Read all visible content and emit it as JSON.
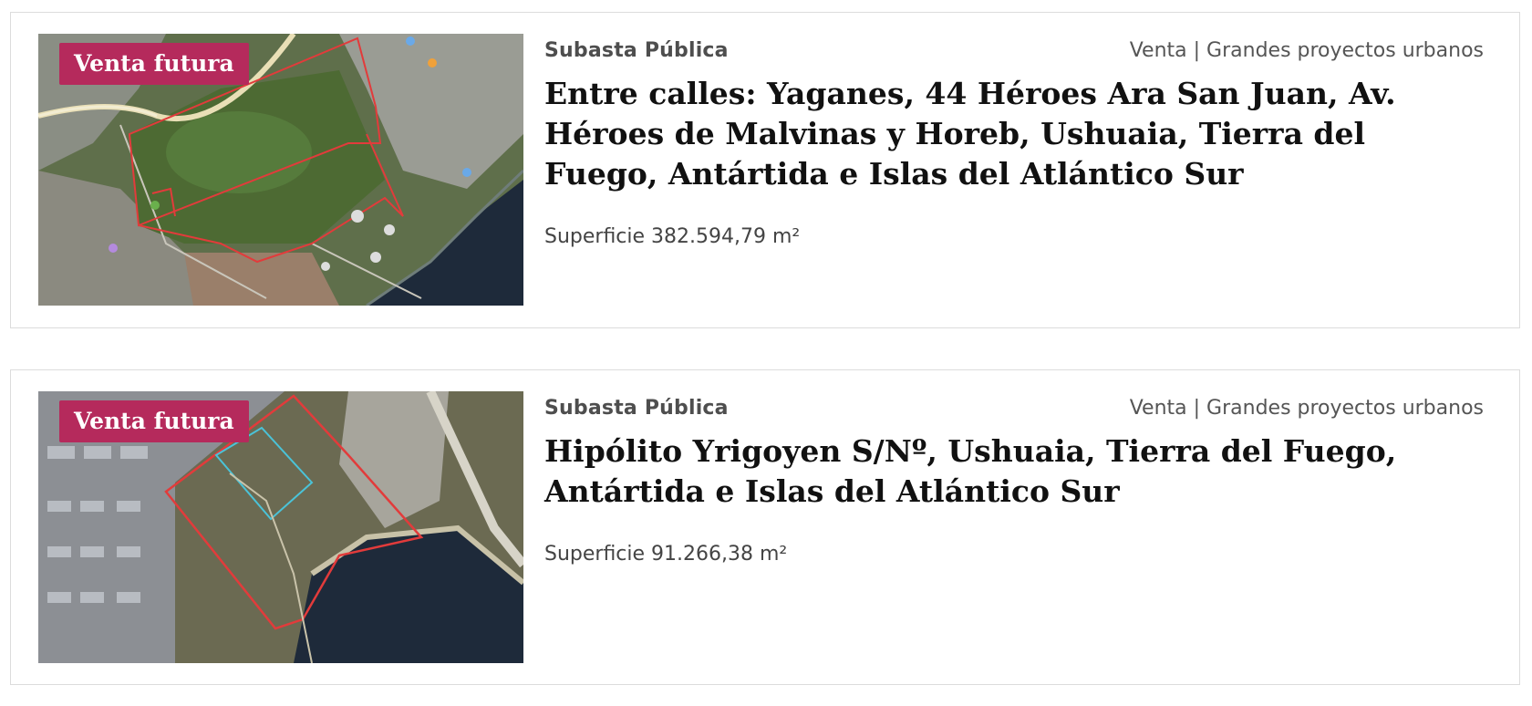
{
  "listings": [
    {
      "badge": "Venta futura",
      "type": "Subasta Pública",
      "category": "Venta | Grandes proyectos urbanos",
      "title": "Entre calles: Yaganes, 44 Héroes Ara San Juan, Av. Héroes de Malvinas y Horeb, Ushuaia, Tierra del Fuego, Antártida e Islas del Atlántico Sur",
      "surface": "Superficie 382.594,79 m²",
      "image": "satellite-map-yaganes"
    },
    {
      "badge": "Venta futura",
      "type": "Subasta Pública",
      "category": "Venta | Grandes proyectos urbanos",
      "title": "Hipólito Yrigoyen S/Nº, Ushuaia, Tierra del Fuego, Antártida e Islas del Atlántico Sur",
      "surface": "Superficie 91.266,38 m²",
      "image": "satellite-map-yrigoyen"
    }
  ],
  "colors": {
    "badge_bg": "#b52a5c",
    "plot_outline": "#e23b3b",
    "water": "#1e2a3a"
  }
}
